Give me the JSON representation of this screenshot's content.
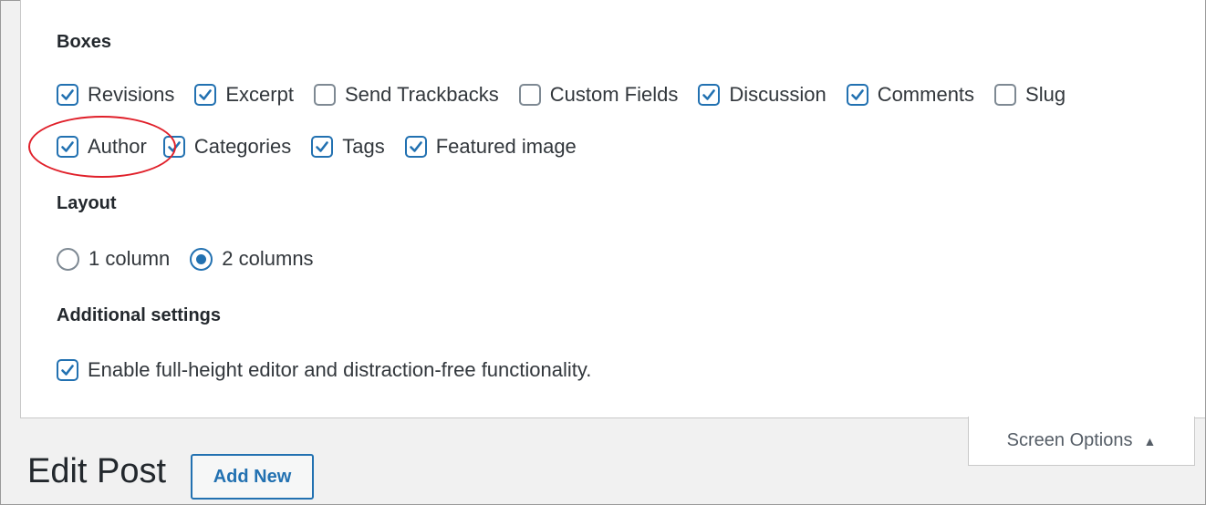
{
  "screen_options": {
    "boxes_heading": "Boxes",
    "boxes": [
      {
        "label": "Revisions",
        "checked": true
      },
      {
        "label": "Excerpt",
        "checked": true
      },
      {
        "label": "Send Trackbacks",
        "checked": false
      },
      {
        "label": "Custom Fields",
        "checked": false
      },
      {
        "label": "Discussion",
        "checked": true
      },
      {
        "label": "Comments",
        "checked": true
      },
      {
        "label": "Slug",
        "checked": false
      },
      {
        "label": "Author",
        "checked": true
      },
      {
        "label": "Categories",
        "checked": true
      },
      {
        "label": "Tags",
        "checked": true
      },
      {
        "label": "Featured image",
        "checked": true
      }
    ],
    "layout_heading": "Layout",
    "layout_options": [
      {
        "label": "1 column",
        "selected": false
      },
      {
        "label": "2 columns",
        "selected": true
      }
    ],
    "additional_heading": "Additional settings",
    "additional": [
      {
        "label": "Enable full-height editor and distraction-free functionality.",
        "checked": true
      }
    ]
  },
  "tab": {
    "label": "Screen Options",
    "arrow": "▲"
  },
  "page": {
    "title": "Edit Post",
    "add_new": "Add New"
  },
  "colors": {
    "accent": "#2271b1",
    "annotation": "#e0202a"
  }
}
